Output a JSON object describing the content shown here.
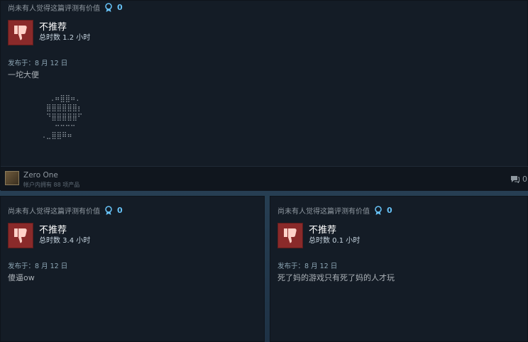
{
  "colors": {
    "accent": "#66c0f4",
    "thumb_bg": "#8a2a2a",
    "card_bg": "#141c26",
    "page_bg": "#1b2838"
  },
  "reviews": [
    {
      "helpful_text": "尚未有人觉得这篇评测有价值",
      "award_count": "0",
      "award_icon": "award-ribbon-icon",
      "vote_icon": "thumbs-down-icon",
      "vote_title": "不推荐",
      "hours": "总时数 1.2 小时",
      "posted": "发布于：8 月 12 日",
      "body": "一坨大便",
      "ascii_art": "  .⠶⣿⣿⠶.\n ⣿⣿⣿⣿⣿⣿⡆\n ⠙⣿⣿⣿⣿⣿⠋\n   ⠒⠒⠒⠒\n.⣀⣿⣿⠿⠶",
      "author": {
        "name": "Zero One",
        "meta": "帐户内拥有 88 项产品",
        "comment_count": "0",
        "comment_icon": "comment-bubble-icon"
      }
    },
    {
      "helpful_text": "尚未有人觉得这篇评测有价值",
      "award_count": "0",
      "award_icon": "award-ribbon-icon",
      "vote_icon": "thumbs-down-icon",
      "vote_title": "不推荐",
      "hours": "总时数 3.4 小时",
      "posted": "发布于：8 月 12 日",
      "body": "傻逼ow"
    },
    {
      "helpful_text": "尚未有人觉得这篇评测有价值",
      "award_count": "0",
      "award_icon": "award-ribbon-icon",
      "vote_icon": "thumbs-down-icon",
      "vote_title": "不推荐",
      "hours": "总时数 0.1 小时",
      "posted": "发布于：8 月 12 日",
      "body": "死了妈的游戏只有死了妈的人才玩"
    }
  ]
}
